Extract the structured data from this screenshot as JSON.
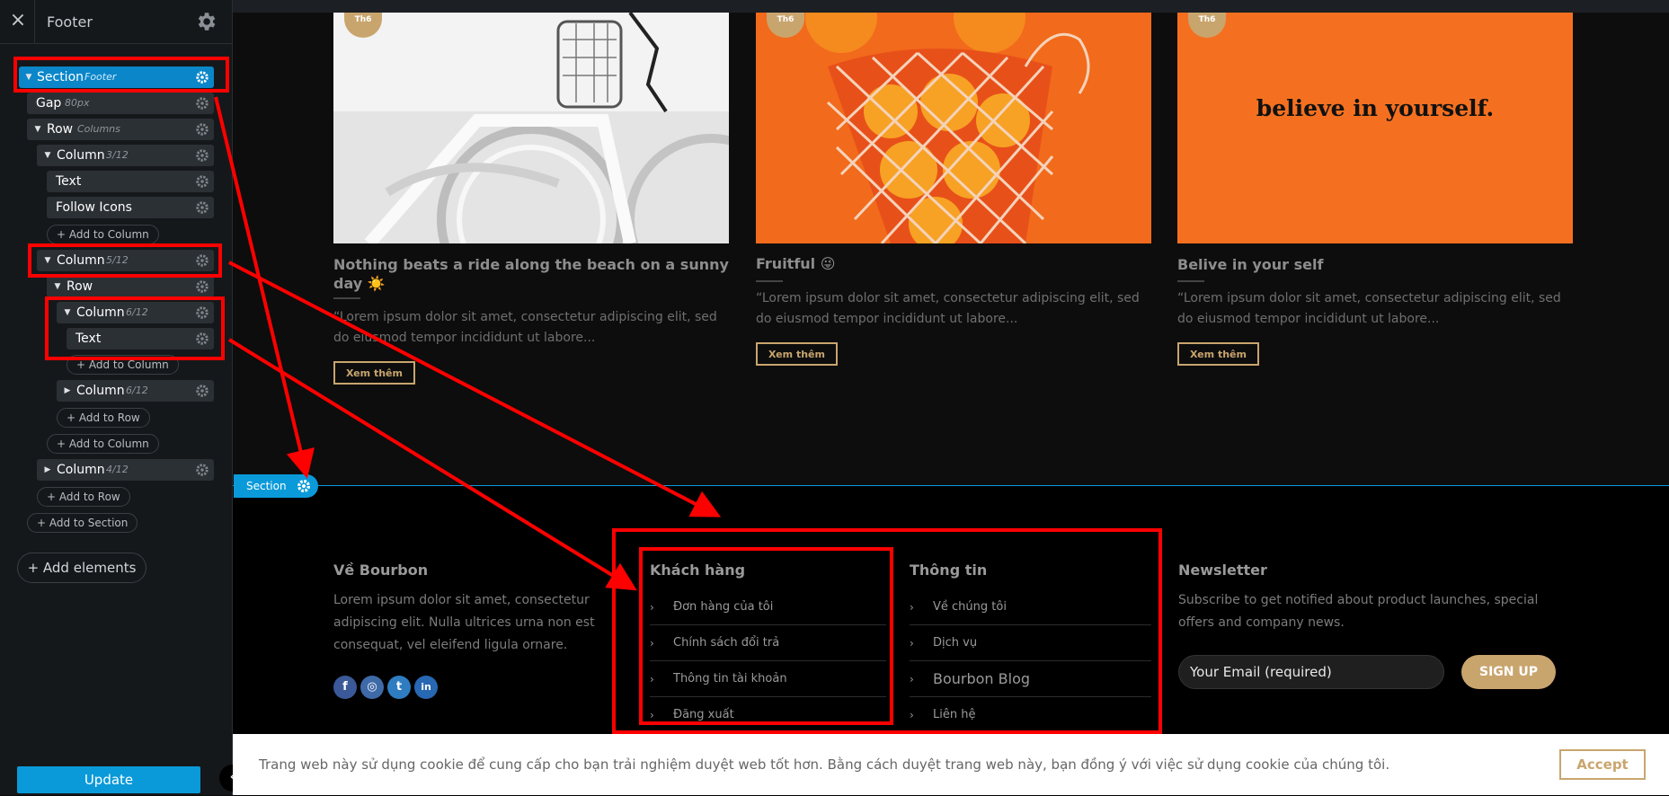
{
  "panel": {
    "close_icon": "×",
    "title": "Footer",
    "tree": [
      {
        "label": "Section",
        "sub": "Footer",
        "caret": "▼"
      },
      {
        "label": "Gap",
        "sub": "80px",
        "caret": ""
      },
      {
        "label": "Row",
        "sub": "Columns",
        "caret": "▼"
      },
      {
        "label": "Column",
        "sub": "3/12",
        "caret": "▼"
      },
      {
        "label": "Text",
        "sub": "",
        "caret": ""
      },
      {
        "label": "Follow Icons",
        "sub": "",
        "caret": ""
      },
      {
        "label": "Column",
        "sub": "5/12",
        "caret": "▼"
      },
      {
        "label": "Row",
        "sub": "",
        "caret": "▼"
      },
      {
        "label": "Column",
        "sub": "6/12",
        "caret": "▼"
      },
      {
        "label": "Text",
        "sub": "",
        "caret": ""
      },
      {
        "label": "Column",
        "sub": "6/12",
        "caret": "▶"
      },
      {
        "label": "Column",
        "sub": "4/12",
        "caret": "▶"
      }
    ],
    "add_column": "+ Add to Column",
    "add_row": "+ Add to Row",
    "add_section": "+ Add to Section",
    "add_elements": "+ Add elements",
    "update": "Update",
    "collapse_icon": "‹"
  },
  "posts": [
    {
      "badge": "Th6",
      "title": "Nothing beats a ride along the beach on a sunny day ☀️",
      "excerpt": "“Lorem ipsum dolor sit amet, consectetur adipiscing elit, sed do eiusmod tempor incididunt ut labore...",
      "button": "Xem thêm"
    },
    {
      "badge": "Th6",
      "title": "Fruitful 😜",
      "excerpt": "“Lorem ipsum dolor sit amet, consectetur adipiscing elit, sed do eiusmod tempor incididunt ut labore...",
      "button": "Xem thêm"
    },
    {
      "badge": "Th6",
      "title": "Belive in your self",
      "excerpt": "“Lorem ipsum dolor sit amet, consectetur adipiscing elit, sed do eiusmod tempor incididunt ut labore...",
      "button": "Xem thêm",
      "image_text": "believe in yourself."
    }
  ],
  "section_tag": "Section",
  "footer": {
    "about": {
      "heading": "Về Bourbon",
      "text": "Lorem ipsum dolor sit amet, consectetur adipiscing elit. Nulla ultrices urna non est consequat, vel eleifend ligula ornare."
    },
    "social": [
      "f",
      "◎",
      "t",
      "in"
    ],
    "customers": {
      "heading": "Khách hàng",
      "links": [
        "Đơn hàng của tôi",
        "Chính sách đổi trả",
        "Thông tin tài khoản",
        "Đăng xuất"
      ]
    },
    "info": {
      "heading": "Thông tin",
      "links": [
        "Về chúng tôi",
        "Dịch vụ",
        "Bourbon Blog",
        "Liên hệ"
      ]
    },
    "newsletter": {
      "heading": "Newsletter",
      "text": "Subscribe to get notified about product launches, special offers and company news.",
      "email_placeholder": "Your Email (required)",
      "signup": "SIGN UP"
    }
  },
  "cookie": {
    "text": "Trang web này sử dụng cookie để cung cấp cho bạn trải nghiệm duyệt web tốt hơn. Bằng cách duyệt trang web này, bạn đồng ý với việc sử dụng cookie của chúng tôi.",
    "accept": "Accept"
  },
  "colors": {
    "accent_gold": "#c9a56e",
    "builder_blue": "#0a9ad9",
    "annotation_red": "#ff0000"
  }
}
